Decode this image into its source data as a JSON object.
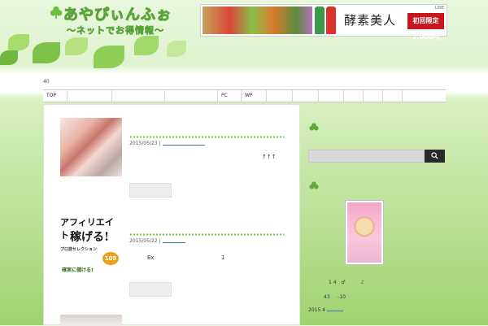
{
  "header": {
    "logo_main": "あやぴぃんふぉ",
    "logo_sub": "～ネットでお得情報～",
    "banner": {
      "pr": "LINE",
      "title": "酵素美人",
      "badge": "初回限定 2,000円"
    }
  },
  "counter": "40",
  "nav": {
    "items": [
      "TOP",
      "",
      "",
      "",
      "PC",
      "WP",
      "",
      "",
      "",
      "",
      "",
      "",
      ""
    ]
  },
  "posts": [
    {
      "date": "2015/05/23 |",
      "arrows": "↑↑↑"
    },
    {
      "date": "2015/05/22 |",
      "thumb_title": "アフィリエイト",
      "thumb_sub": "稼げる!",
      "thumb_badge": "プロ技セレクション",
      "thumb_num": "109",
      "thumb_footer": "確実に儲ける!",
      "excerpt_left": "Ex",
      "excerpt_right": "1"
    }
  ],
  "sidebar": {
    "search_icon": "magnifier-icon",
    "profile_line1": "1 4   ♂          ♪",
    "profile_line2": "43     -10",
    "profile_line3": "2015 4"
  },
  "colors": {
    "accent": "#7cc44a",
    "link": "#3a6fc4"
  }
}
